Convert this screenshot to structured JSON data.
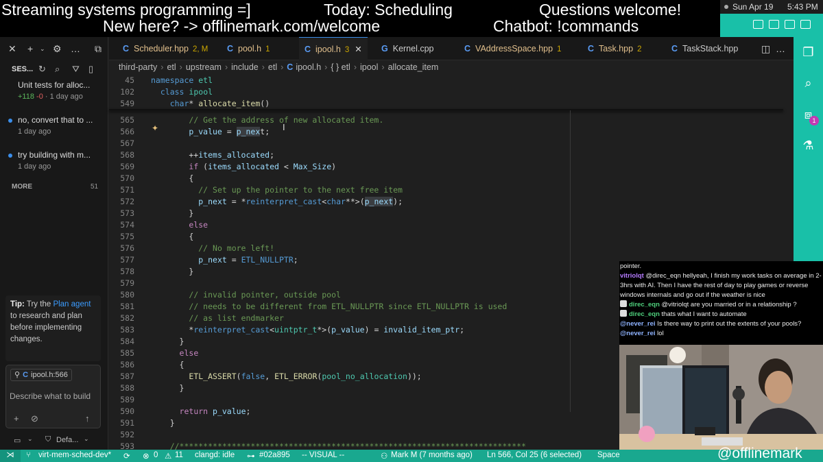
{
  "banner": {
    "line1_left": "Streaming systems programming =]",
    "line1_mid": "Today: Scheduling",
    "line1_right": "Questions welcome!",
    "line2_left": "New here? -> offlinemark.com/welcome",
    "line2_right": "Chatbot: !commands"
  },
  "mac": {
    "date": "Sun Apr 19",
    "time": "5:43 PM"
  },
  "sessions": {
    "title": "SES...",
    "items": [
      {
        "title": "Unit tests for alloc...",
        "diff_add": "+118",
        "diff_del": "-0",
        "age": "1 day ago"
      },
      {
        "title": "no, convert that to ...",
        "age": "1 day ago"
      },
      {
        "title": "try building with m...",
        "age": "1 day ago"
      }
    ],
    "more_label": "MORE",
    "more_count": "51"
  },
  "tip": {
    "label": "Tip:",
    "before": "Try the",
    "link": "Plan agent",
    "after": "to research and plan before implementing changes."
  },
  "chat_panel": {
    "context_chip": "ipool.h:566",
    "input_placeholder": "Describe what to build",
    "mode": "Defa..."
  },
  "tabs": [
    {
      "icon": "C",
      "label": "Scheduler.hpp",
      "badge": "2, M",
      "color": "#e2c08d"
    },
    {
      "icon": "C",
      "label": "pool.h",
      "badge": "1",
      "color": "#e2c08d"
    },
    {
      "icon": "C",
      "label": "ipool.h",
      "badge": "3",
      "color": "#e2c08d",
      "active": true
    },
    {
      "icon": "G",
      "label": "Kernel.cpp",
      "badge": "",
      "color": "#cccccc"
    },
    {
      "icon": "C",
      "label": "VAddressSpace.hpp",
      "badge": "1",
      "color": "#e2c08d"
    },
    {
      "icon": "C",
      "label": "Task.hpp",
      "badge": "2",
      "color": "#e2c08d"
    },
    {
      "icon": "C",
      "label": "TaskStack.hpp",
      "badge": "",
      "color": "#cccccc"
    }
  ],
  "breadcrumb": [
    "third-party",
    "etl",
    "upstream",
    "include",
    "etl",
    "ipool.h",
    "{ } etl",
    "ipool",
    "allocate_item"
  ],
  "code_lines": [
    {
      "n": "45",
      "h": "<span class=\"kw\">namespace</span> <span class=\"ty\">etl</span>"
    },
    {
      "n": "102",
      "h": "  <span class=\"kw\">class</span> <span class=\"ty\">ipool</span>"
    },
    {
      "n": "549",
      "h": "    <span class=\"kw\">char</span>* <span class=\"fn\">allocate_item</span>()"
    },
    {
      "n": "565",
      "h": "        <span class=\"cm\">// Get the address of new allocated item.</span>"
    },
    {
      "n": "566",
      "h": "        <span class=\"vr\">p_value</span> = <span class=\"vr hl\">p_nex</span>t;"
    },
    {
      "n": "567",
      "h": ""
    },
    {
      "n": "568",
      "h": "        ++<span class=\"vr\">items_allocated</span>;"
    },
    {
      "n": "569",
      "h": "        <span class=\"kc\">if</span> (<span class=\"vr\">items_allocated</span> &lt; <span class=\"vr\">Max_Size</span>)"
    },
    {
      "n": "570",
      "h": "        {"
    },
    {
      "n": "571",
      "h": "          <span class=\"cm\">// Set up the pointer to the next free item</span>"
    },
    {
      "n": "572",
      "h": "          <span class=\"vr\">p_next</span> = *<span class=\"kw\">reinterpret_cast</span>&lt;<span class=\"kw\">char</span>**&gt;(<span class=\"vr hl\">p_next</span>);"
    },
    {
      "n": "573",
      "h": "        }"
    },
    {
      "n": "574",
      "h": "        <span class=\"kc\">else</span>"
    },
    {
      "n": "575",
      "h": "        {"
    },
    {
      "n": "576",
      "h": "          <span class=\"cm\">// No more left!</span>"
    },
    {
      "n": "577",
      "h": "          <span class=\"vr\">p_next</span> = <span class=\"kw\">ETL_NULLPTR</span>;"
    },
    {
      "n": "578",
      "h": "        }"
    },
    {
      "n": "579",
      "h": ""
    },
    {
      "n": "580",
      "h": "        <span class=\"cm\">// invalid pointer, outside pool</span>"
    },
    {
      "n": "581",
      "h": "        <span class=\"cm\">// needs to be different from ETL_NULLPTR since ETL_NULLPTR is used</span>"
    },
    {
      "n": "582",
      "h": "        <span class=\"cm\">// as list endmarker</span>"
    },
    {
      "n": "583",
      "h": "        *<span class=\"kw\">reinterpret_cast</span>&lt;<span class=\"ty\">uintptr_t</span>*&gt;(<span class=\"vr\">p_value</span>) = <span class=\"vr\">invalid_item_ptr</span>;"
    },
    {
      "n": "584",
      "h": "      }"
    },
    {
      "n": "585",
      "h": "      <span class=\"kc\">else</span>"
    },
    {
      "n": "586",
      "h": "      {"
    },
    {
      "n": "587",
      "h": "        <span class=\"fn\">ETL_ASSERT</span>(<span class=\"kw\">false</span>, <span class=\"fn\">ETL_ERROR</span>(<span class=\"ty\">pool_no_allocation</span>));"
    },
    {
      "n": "588",
      "h": "      }"
    },
    {
      "n": "589",
      "h": ""
    },
    {
      "n": "590",
      "h": "      <span class=\"kc\">return</span> <span class=\"vr\">p_value</span>;"
    },
    {
      "n": "591",
      "h": "    }"
    },
    {
      "n": "592",
      "h": ""
    },
    {
      "n": "593",
      "h": "    <span class=\"cm\">//*************************************************************************</span>"
    }
  ],
  "status": {
    "branch": "virt-mem-sched-dev*",
    "errors": "0",
    "warnings": "11",
    "clangd": "clangd: idle",
    "commit": "#02a895",
    "mode": "-- VISUAL --",
    "blame": "Mark M (7 months ago)",
    "position": "Ln 566, Col 25 (6 selected)",
    "spaces": "Space"
  },
  "twitch_chat": [
    {
      "user": "",
      "color": "#ffffff",
      "text": "pointer."
    },
    {
      "user": "vitriolqt",
      "color": "#b57bff",
      "text": "@direc_eqn hellyeah, I finish my work tasks on average in 2-3hrs with AI. Then I have the rest of day to play games or reverse windows internals and go out if the weather is nice"
    },
    {
      "user": "direc_eqn",
      "color": "#4fd17d",
      "text": "@vitriolqt are you married or in a relationship ?",
      "badge": true
    },
    {
      "user": "direc_eqn",
      "color": "#4fd17d",
      "text": "thats what I want to automate",
      "badge": true
    },
    {
      "user": "@never_rei",
      "color": "#8fb3ff",
      "text": "Is there way to print out the extents of your pools?"
    },
    {
      "user": "@never_rei",
      "color": "#8fb3ff",
      "text": "lol"
    }
  ],
  "handle": "@offlinemark",
  "colors": {
    "accent": "#19c0a8",
    "status_bar": "#19a88f",
    "editor_bg": "#1f1f1f"
  }
}
